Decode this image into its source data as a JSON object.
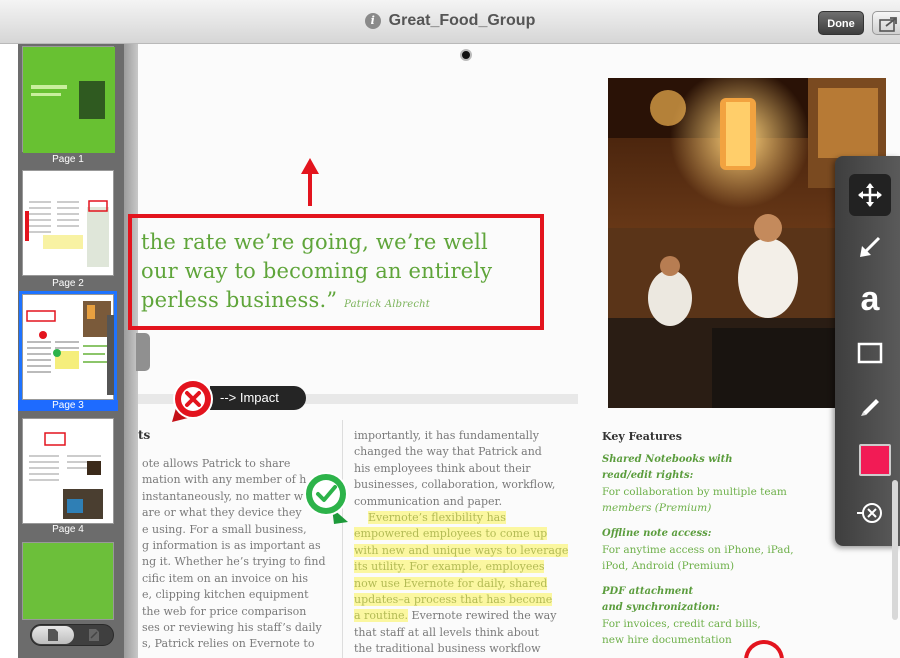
{
  "window": {
    "title": "Great_Food_Group",
    "info_icon": "info-icon",
    "done_label": "Done",
    "share_icon": "share-icon"
  },
  "sidebar": {
    "pages": [
      {
        "label": "Page 1"
      },
      {
        "label": "Page 2"
      },
      {
        "label": "Page 3",
        "selected": true
      },
      {
        "label": "Page 4"
      }
    ],
    "view_toggle": [
      "page-view-icon",
      "annotation-view-icon"
    ]
  },
  "quote": {
    "lines": [
      "the rate we’re going, we’re well",
      "our way to becoming an entirely",
      "perless business.”"
    ],
    "author": "Patrick Albrecht"
  },
  "annotation": {
    "impact_label": "--> Impact"
  },
  "section_heading": "ts",
  "left_column": [
    "ote allows Patrick to share",
    "mation with any member of h",
    "instantaneously, no matter w",
    "are or what they device they",
    "e using. For a small business,",
    "g information is as important as",
    "ng it. Whether he’s trying to find",
    "cific item on an invoice on his",
    "e, clipping kitchen equipment",
    "the web for price comparison",
    "ses or reviewing his staff’s daily",
    "s, Patrick relies on Evernote to"
  ],
  "middle_column": {
    "before": [
      "importantly, it has fundamentally",
      "changed the way that Patrick and",
      "his employees think about their",
      "businesses, collaboration, workflow,",
      "communication and paper."
    ],
    "highlighted": [
      "Evernote’s flexibility has",
      "empowered employees to come up",
      "with new and unique ways to leverage",
      "its utility. For example, employees",
      "now use Evernote for daily, shared",
      "updates–a process that has become",
      "a routine."
    ],
    "after_inline": " Evernote rewired the way",
    "after": [
      "that staff at all levels think about",
      "the traditional business workflow"
    ]
  },
  "key_features": {
    "heading": "Key Features",
    "items": [
      {
        "title": [
          "Shared Notebooks with",
          "read/edit rights:"
        ],
        "desc": [
          "For collaboration by multiple team",
          "members (Premium)"
        ]
      },
      {
        "title": [
          "Offline note access:"
        ],
        "desc": [
          "For anytime access on iPhone, iPad,",
          "iPod, Android (Premium)"
        ]
      },
      {
        "title": [
          "PDF attachment",
          "and synchronization:"
        ],
        "desc": [
          "For invoices, credit card bills,",
          "new hire documentation"
        ]
      }
    ]
  },
  "toolbar": {
    "tools": [
      "move-icon",
      "arrow-icon",
      "text-tool-icon",
      "rectangle-icon",
      "pen-icon",
      "color-swatch",
      "eraser-icon"
    ],
    "text_tool_label": "a",
    "swatch_color": "#f21b55"
  },
  "colors": {
    "highlight": "#fbf7a0",
    "annotation_red": "#e3141e",
    "accent_green": "#5fa53a",
    "selection_blue": "#1e73ff"
  }
}
